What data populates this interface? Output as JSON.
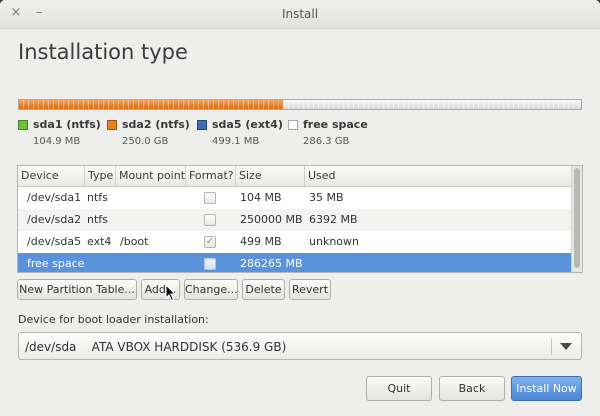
{
  "window": {
    "title": "Install",
    "close_glyph": "×",
    "minimize_glyph": "–"
  },
  "page_title": "Installation type",
  "partition_bar": {
    "used_fraction": 0.47,
    "accent": "#e8841e"
  },
  "legend": [
    {
      "name": "sda1 (ntfs)",
      "size": "104.9 MB",
      "color": "#6ec439"
    },
    {
      "name": "sda2 (ntfs)",
      "size": "250.0 GB",
      "color": "#e8841e"
    },
    {
      "name": "sda5 (ext4)",
      "size": "499.1 MB",
      "color": "#3e6bb4"
    },
    {
      "name": "free space",
      "size": "286.3 GB",
      "color": "#ffffff"
    }
  ],
  "table": {
    "headers": [
      "Device",
      "Type",
      "Mount point",
      "Format?",
      "Size",
      "Used"
    ],
    "rows": [
      {
        "device": "/dev/sda1",
        "type": "ntfs",
        "mount": "",
        "format": false,
        "size": "104 MB",
        "used": "35 MB"
      },
      {
        "device": "/dev/sda2",
        "type": "ntfs",
        "mount": "",
        "format": false,
        "size": "250000 MB",
        "used": "6392 MB"
      },
      {
        "device": "/dev/sda5",
        "type": "ext4",
        "mount": "/boot",
        "format": true,
        "size": "499 MB",
        "used": "unknown"
      },
      {
        "device": "free space",
        "type": "",
        "mount": "",
        "format": false,
        "size": "286265 MB",
        "used": "",
        "selected": true
      }
    ]
  },
  "actions": {
    "new_table": "New Partition Table...",
    "add": "Add...",
    "change": "Change...",
    "delete": "Delete",
    "revert": "Revert"
  },
  "bootloader": {
    "label": "Device for boot loader installation:",
    "value": "/dev/sda    ATA VBOX HARDDISK (536.9 GB)"
  },
  "footer": {
    "quit": "Quit",
    "back": "Back",
    "install": "Install Now"
  },
  "colors": {
    "selection": "#5a93dc",
    "primary_button": "#4b86d3"
  }
}
